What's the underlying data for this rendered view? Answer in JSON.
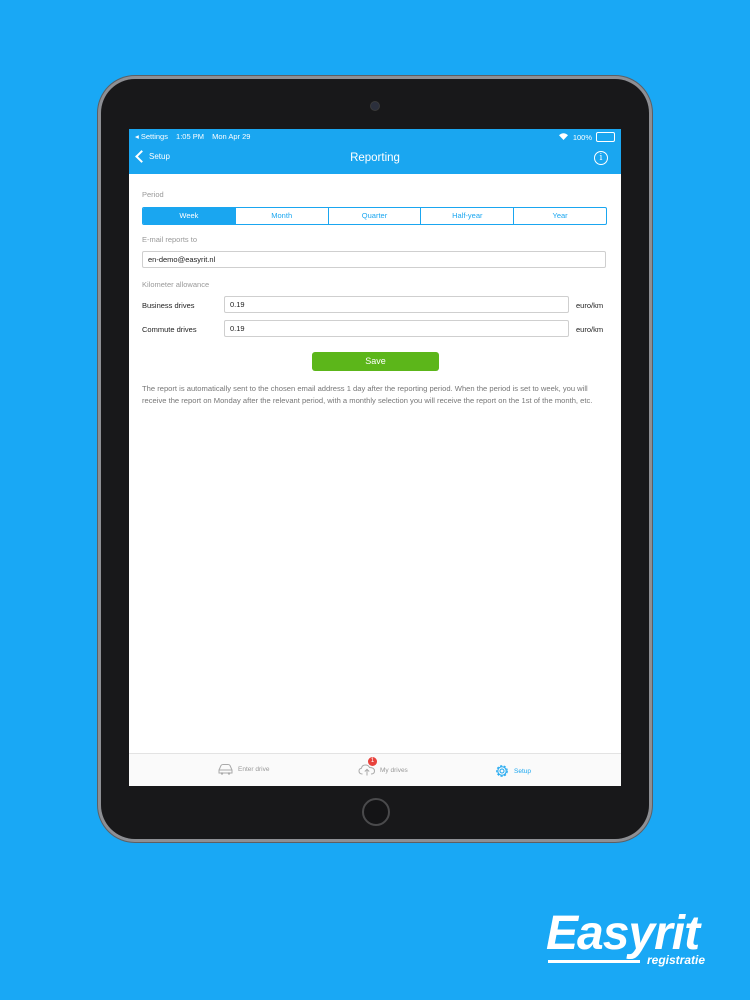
{
  "status": {
    "back_app": "◂ Settings",
    "time": "1:05 PM",
    "date": "Mon Apr 29",
    "battery": "100%"
  },
  "nav": {
    "back_label": "Setup",
    "title": "Reporting",
    "info": "i"
  },
  "period": {
    "label": "Period",
    "options": [
      "Week",
      "Month",
      "Quarter",
      "Half-year",
      "Year"
    ],
    "selected": "Week"
  },
  "email": {
    "label": "E-mail reports to",
    "value": "en-demo@easyrit.nl"
  },
  "allowance": {
    "label": "Kilometer allowance",
    "rows": [
      {
        "label": "Business drives",
        "value": "0.19",
        "unit": "euro/km"
      },
      {
        "label": "Commute drives",
        "value": "0.19",
        "unit": "euro/km"
      }
    ]
  },
  "save_label": "Save",
  "note": "The report is automatically sent to the chosen email address 1 day after the reporting period. When the period is set to week, you will receive the report on Monday after the relevant period, with a monthly selection you will receive the report on the 1st of the month, etc.",
  "tabs": [
    {
      "label": "Enter drive",
      "icon": "car-icon"
    },
    {
      "label": "My drives",
      "icon": "cloud-upload-icon",
      "badge": "1"
    },
    {
      "label": "Setup",
      "icon": "gear-icon"
    }
  ],
  "logo": {
    "word": "Easyrit",
    "sub": "registratie"
  },
  "colors": {
    "background": "#19a8f5",
    "accent": "#1aa6f0",
    "save": "#5cb61a",
    "badge": "#e8423c"
  }
}
